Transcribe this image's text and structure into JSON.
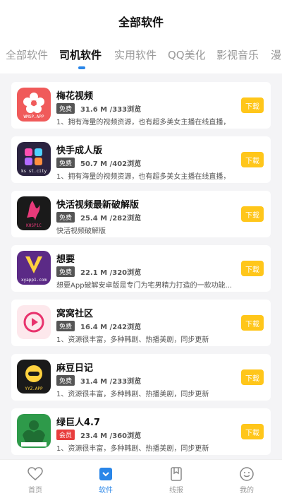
{
  "header": {
    "title": "全部软件"
  },
  "tabs": [
    {
      "label": "全部软件",
      "active": false
    },
    {
      "label": "司机软件",
      "active": true
    },
    {
      "label": "实用软件",
      "active": false
    },
    {
      "label": "QQ美化",
      "active": false
    },
    {
      "label": "影视音乐",
      "active": false
    },
    {
      "label": "漫",
      "active": false
    }
  ],
  "apps": [
    {
      "name": "梅花视频",
      "badge": "免费",
      "size": "31.6 M /333浏览",
      "desc": "1、拥有海量的视频资源，也有超多美女主播在线直播，",
      "icon_color": "#f05a5a",
      "icon_caption": "WMSP.APP",
      "download_label": "下载"
    },
    {
      "name": "快手成人版",
      "badge": "免费",
      "size": "50.7 M /402浏览",
      "desc": "1、拥有海量的视频资源，也有超多美女主播在线直播，",
      "icon_color": "#2b2340",
      "icon_caption": "ks st.city",
      "download_label": "下载"
    },
    {
      "name": "快活视频最新破解版",
      "badge": "免费",
      "size": "25.4 M /282浏览",
      "desc": "快活视频破解版",
      "icon_color": "#1a1a1a",
      "icon_caption": "KHSP1C",
      "download_label": "下载"
    },
    {
      "name": "想要",
      "badge": "免费",
      "size": "22.1 M /320浏览",
      "desc": "想要App破解安卓版是专门为宅男精力打造的一款功能...",
      "icon_color": "#5b2a86",
      "icon_caption": "xyapp1.com",
      "download_label": "下载"
    },
    {
      "name": "窝窝社区",
      "badge": "免费",
      "size": "16.4 M /242浏览",
      "desc": "1、资源很丰富，多种韩剧、热播美剧，同步更新",
      "icon_color": "#fde8ec",
      "icon_caption": "",
      "download_label": "下载"
    },
    {
      "name": "麻豆日记",
      "badge": "免费",
      "size": "31.4 M /233浏览",
      "desc": "1、资源很丰富，多种韩剧、热播美剧，同步更新",
      "icon_color": "#1a1a1a",
      "icon_caption": "YYZ.APP",
      "download_label": "下载"
    },
    {
      "name": "绿巨人4.7",
      "badge": "会员",
      "size": "23.4 M /360浏览",
      "desc": "1、资源很丰富，多种韩剧、热播美剧，同步更新",
      "icon_color": "#2e9a4a",
      "icon_caption": "",
      "download_label": "下载"
    }
  ],
  "bottom_nav": [
    {
      "label": "首页",
      "icon": "heart-icon",
      "active": false
    },
    {
      "label": "软件",
      "icon": "apps-icon",
      "active": true
    },
    {
      "label": "线报",
      "icon": "bookmark-icon",
      "active": false
    },
    {
      "label": "我的",
      "icon": "smiley-icon",
      "active": false
    }
  ],
  "colors": {
    "accent": "#2a86e8",
    "download": "#ffc61a",
    "badge_vip": "#e83d3d"
  }
}
